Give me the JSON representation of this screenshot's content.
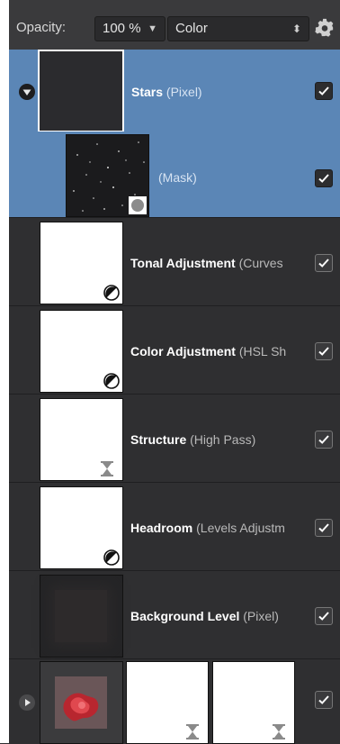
{
  "toolbar": {
    "opacity_label": "Opacity:",
    "opacity_value": "100 %",
    "blend_mode": "Color",
    "settings_icon": "gear-icon"
  },
  "layers": [
    {
      "name": "Stars",
      "type": "(Pixel)",
      "selected": true,
      "expanded": true,
      "visible": true
    },
    {
      "name": "",
      "type": "(Mask)",
      "selected": true,
      "visible": true
    },
    {
      "name": "Tonal Adjustment",
      "type": "(Curves",
      "visible": true
    },
    {
      "name": "Color Adjustment",
      "type": "(HSL Sh",
      "visible": true
    },
    {
      "name": "Structure",
      "type": "(High Pass)",
      "visible": true
    },
    {
      "name": "Headroom",
      "type": "(Levels Adjustm",
      "visible": true
    },
    {
      "name": "Background Level",
      "type": "(Pixel)",
      "visible": true
    },
    {
      "name": "",
      "type": "",
      "collapsed": true,
      "visible": true
    }
  ],
  "colors": {
    "selection": "#5b86b6",
    "panel": "#2f2f31"
  }
}
